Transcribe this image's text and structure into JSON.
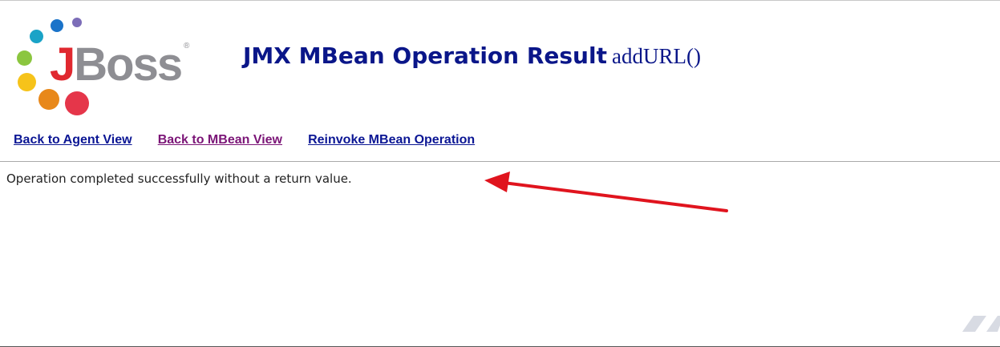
{
  "logo": {
    "wordmark_j": "J",
    "wordmark_rest": "Boss",
    "registered": "®"
  },
  "header": {
    "title": "JMX MBean Operation Result",
    "operation": "addURL()"
  },
  "nav": {
    "links": [
      {
        "label": "Back to Agent View",
        "state": "unvisited"
      },
      {
        "label": "Back to MBean View",
        "state": "visited"
      },
      {
        "label": "Reinvoke MBean Operation",
        "state": "unvisited"
      }
    ]
  },
  "result": {
    "message": "Operation completed successfully without a return value."
  },
  "annotation": {
    "arrow_color": "#e0141e"
  },
  "colors": {
    "title": "#0a1689",
    "link": "#0b1694",
    "link_visited": "#7b1577",
    "logo_red": "#e0282f",
    "logo_gray": "#8e8e93"
  }
}
